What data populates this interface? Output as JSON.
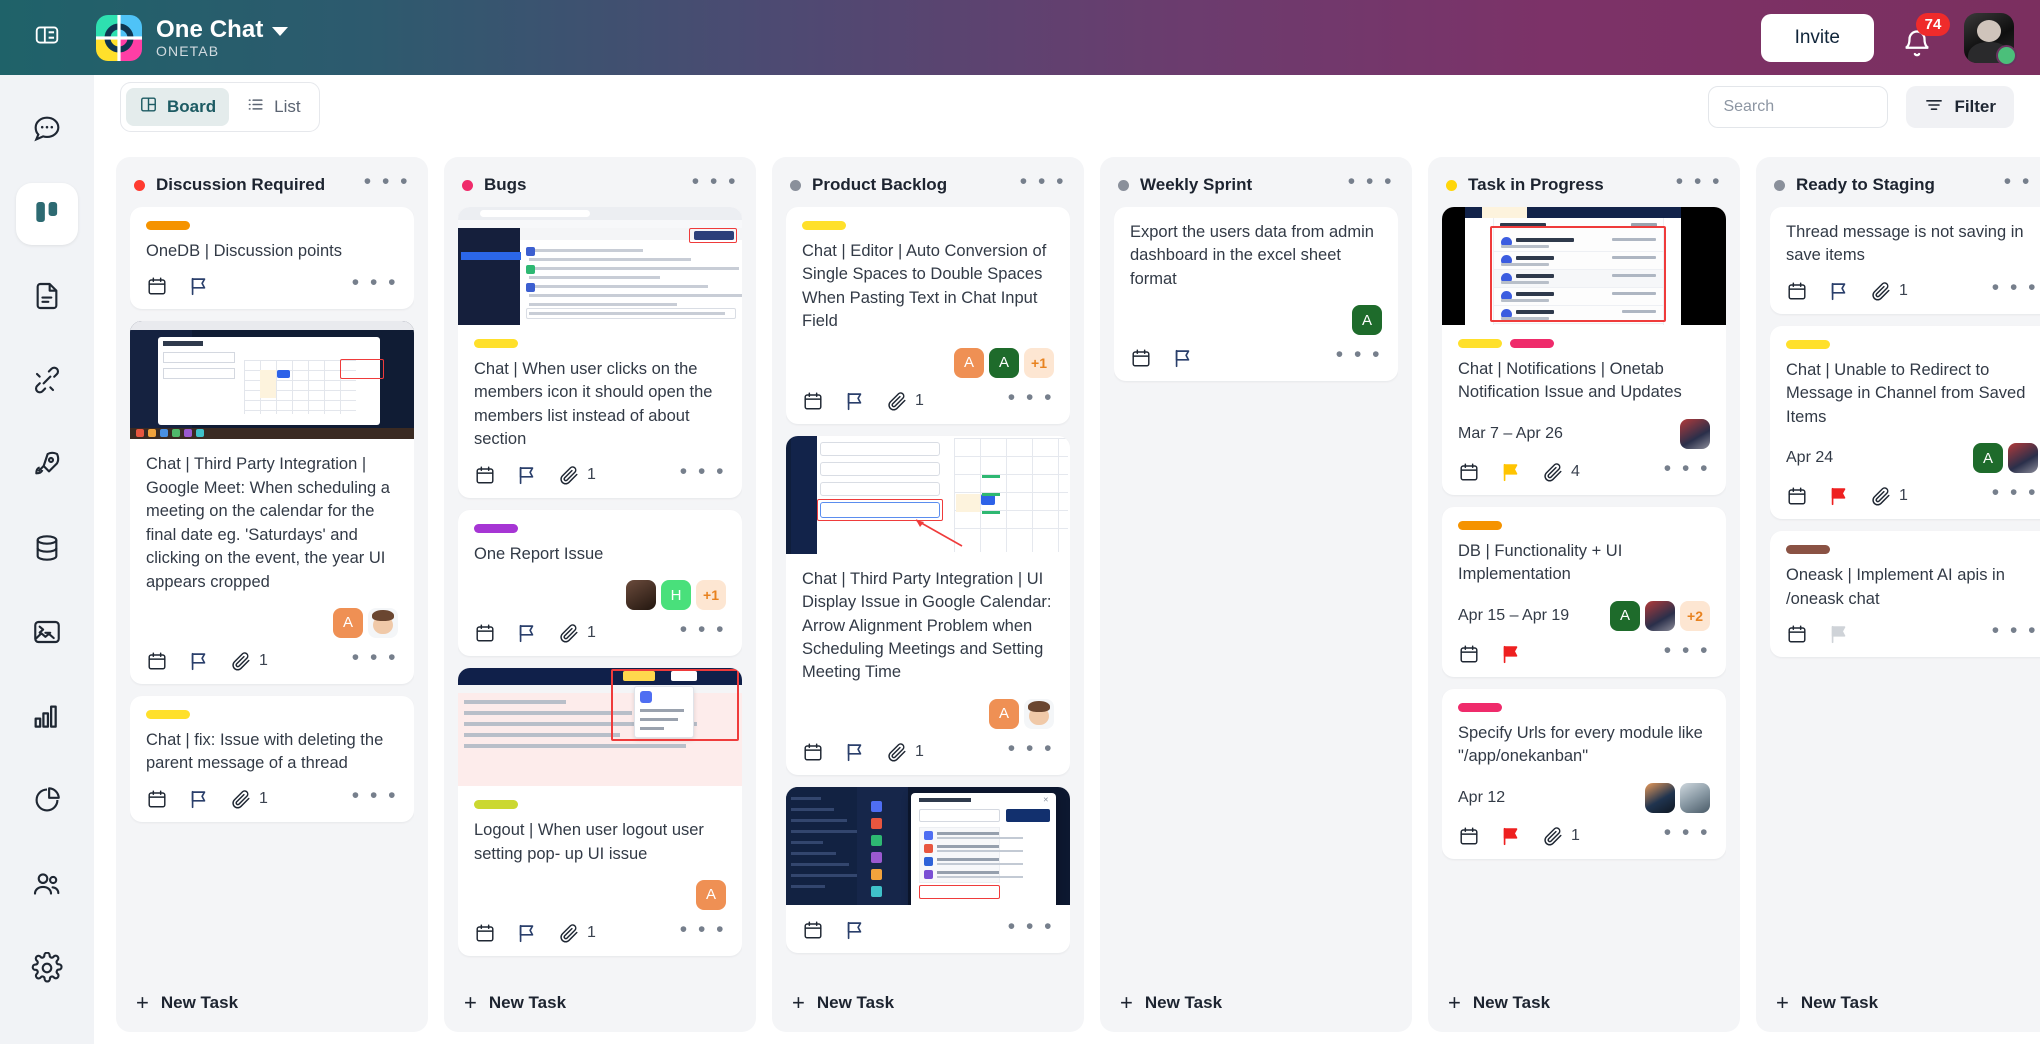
{
  "topbar": {
    "panel_toggle_icon": "panel-layout-icon",
    "brand_title": "One Chat",
    "brand_subtitle": "ONETAB",
    "brand_chevron_icon": "chevron-down-icon",
    "invite_label": "Invite",
    "bell_icon": "bell-icon",
    "notification_count": "74",
    "avatar_icon": "user-avatar",
    "gradient_from": "#1f6269",
    "gradient_to": "#7b2f5f"
  },
  "rail": {
    "items": [
      {
        "name": "chat",
        "icon": "chat-bubble-icon",
        "active": false
      },
      {
        "name": "board",
        "icon": "board-columns-icon",
        "active": true
      },
      {
        "name": "docs",
        "icon": "document-icon",
        "active": false
      },
      {
        "name": "integrations",
        "icon": "plug-connect-icon",
        "active": false
      },
      {
        "name": "launch",
        "icon": "rocket-icon",
        "active": false
      },
      {
        "name": "database",
        "icon": "database-icon",
        "active": false
      },
      {
        "name": "terminal",
        "icon": "terminal-image-icon",
        "active": false
      },
      {
        "name": "analytics",
        "icon": "bar-chart-icon",
        "active": false
      },
      {
        "name": "reports",
        "icon": "pie-chart-icon",
        "active": false
      },
      {
        "name": "members",
        "icon": "users-icon",
        "active": false
      },
      {
        "name": "settings",
        "icon": "gear-icon",
        "active": false
      }
    ]
  },
  "toolbar": {
    "board_tab": "Board",
    "board_icon": "board-grid-icon",
    "list_tab": "List",
    "list_icon": "list-icon",
    "search_placeholder": "Search",
    "search_value": "",
    "search_icon": "search-icon",
    "filter_label": "Filter",
    "filter_icon": "filter-icon",
    "menu_glyph": "• • •",
    "plus_glyph": "+"
  },
  "columns": [
    {
      "title": "Discussion Required",
      "dot_color": "#ff3b30",
      "new_task_label": "New Task",
      "cards": [
        {
          "title": "OneDB | Discussion points",
          "labels": [
            "#f59300"
          ],
          "cover": null,
          "date": "",
          "attachments": "",
          "avatars": [],
          "flag_color": "#2a3f6b"
        },
        {
          "title": "Chat | Third Party Integration | Google Meet: When scheduling a meeting on the calendar for the final date eg. 'Saturdays' and clicking on the event, the year UI appears cropped",
          "labels": [],
          "cover": "calendar-create-meet-screenshot",
          "date": "",
          "attachments": "1",
          "avatars": [
            {
              "type": "initial",
              "text": "A",
              "color": "#ef9054"
            },
            {
              "type": "memoji",
              "text": ""
            }
          ],
          "flag_color": "#2a3f6b"
        },
        {
          "title": "Chat | fix: Issue with deleting the parent message of a thread",
          "labels": [
            "#ffe02b"
          ],
          "cover": null,
          "date": "",
          "attachments": "1",
          "avatars": [],
          "flag_color": "#2a3f6b"
        }
      ]
    },
    {
      "title": "Bugs",
      "dot_color": "#ef2b6b",
      "new_task_label": "New Task",
      "cards": [
        {
          "title": "Chat | When user clicks on the members icon it should open the members list instead of about section",
          "labels": [
            "#ffe02b"
          ],
          "cover": "chat-channel-browser-screenshot",
          "date": "",
          "attachments": "1",
          "avatars": [],
          "flag_color": "#2a3f6b"
        },
        {
          "title": "One Report Issue",
          "labels": [
            "#a635d4"
          ],
          "cover": null,
          "date": "",
          "attachments": "1",
          "avatars": [
            {
              "type": "photo-a",
              "text": ""
            },
            {
              "type": "initial",
              "text": "H",
              "color": "#49e07b"
            },
            {
              "type": "more",
              "text": "+1"
            }
          ],
          "flag_color": "#2a3f6b"
        },
        {
          "title": "Logout | When user logout user setting pop- up UI issue",
          "labels": [
            "#cbd831"
          ],
          "cover": "logout-popup-screenshot",
          "date": "",
          "attachments": "1",
          "avatars": [
            {
              "type": "initial",
              "text": "A",
              "color": "#ef9054"
            }
          ],
          "flag_color": "#2a3f6b"
        }
      ]
    },
    {
      "title": "Product Backlog",
      "dot_color": "#8a909b",
      "new_task_label": "New Task",
      "cards": [
        {
          "title": "Chat | Editor | Auto Conversion of Single Spaces to Double Spaces When Pasting Text in Chat Input Field",
          "labels": [
            "#ffe02b"
          ],
          "cover": null,
          "date": "",
          "attachments": "1",
          "avatars": [
            {
              "type": "initial",
              "text": "A",
              "color": "#ef9054"
            },
            {
              "type": "initial",
              "text": "A",
              "color": "#1e6b2b"
            },
            {
              "type": "more",
              "text": "+1"
            }
          ],
          "flag_color": "#2a3f6b"
        },
        {
          "title": "Chat | Third Party Integration | UI Display Issue in Google Calendar: Arrow Alignment Problem when Scheduling Meetings and Setting Meeting Time",
          "labels": [],
          "cover": "google-calendar-schedule-screenshot",
          "date": "",
          "attachments": "1",
          "avatars": [
            {
              "type": "initial",
              "text": "A",
              "color": "#ef9054"
            },
            {
              "type": "memoji",
              "text": ""
            }
          ],
          "flag_color": "#2a3f6b"
        },
        {
          "title": "",
          "labels": [],
          "cover": "workspace-invite-screenshot",
          "date": "",
          "attachments": "",
          "avatars": [],
          "flag_color": "#2a3f6b"
        }
      ]
    },
    {
      "title": "Weekly Sprint",
      "dot_color": "#8a909b",
      "new_task_label": "New Task",
      "cards": [
        {
          "title": "Export the users data from admin dashboard in the excel sheet format",
          "labels": [],
          "cover": null,
          "date": "",
          "attachments": "",
          "avatars": [
            {
              "type": "initial",
              "text": "A",
              "color": "#1e6b2b"
            }
          ],
          "flag_color": "#2a3f6b"
        }
      ]
    },
    {
      "title": "Task in Progress",
      "dot_color": "#ffd60a",
      "new_task_label": "New Task",
      "cards": [
        {
          "title": "Chat | Notifications | Onetab Notification Issue and Updates",
          "labels": [
            "#ffe02b",
            "#ef2b6b"
          ],
          "cover": "notifications-panel-screenshot",
          "date": "Mar 7 – Apr 26",
          "attachments": "4",
          "avatars": [
            {
              "type": "photo-b",
              "text": ""
            }
          ],
          "flag_color": "#ffc400"
        },
        {
          "title": "DB | Functionality + UI Implementation",
          "labels": [
            "#f59300"
          ],
          "cover": null,
          "date": "Apr 15 – Apr 19",
          "attachments": "",
          "avatars": [
            {
              "type": "initial",
              "text": "A",
              "color": "#1e6b2b"
            },
            {
              "type": "photo-b",
              "text": ""
            },
            {
              "type": "more",
              "text": "+2"
            }
          ],
          "flag_color": "#ee2020"
        },
        {
          "title": "Specify Urls for every module like \"/app/onekanban\"",
          "labels": [
            "#ef2b6b"
          ],
          "cover": null,
          "date": "Apr 12",
          "attachments": "1",
          "avatars": [
            {
              "type": "photo-c",
              "text": ""
            },
            {
              "type": "photo-d",
              "text": ""
            }
          ],
          "flag_color": "#ee2020"
        }
      ]
    },
    {
      "title": "Ready to Staging",
      "dot_color": "#8a909b",
      "new_task_label": "New Task",
      "cards": [
        {
          "title": "Thread message is not saving in save items",
          "labels": [],
          "cover": null,
          "date": "",
          "attachments": "1",
          "avatars": [],
          "flag_color": "#2a3f6b"
        },
        {
          "title": "Chat | Unable to Redirect to Message in Channel from Saved Items",
          "labels": [
            "#ffe02b"
          ],
          "cover": null,
          "date": "Apr 24",
          "attachments": "1",
          "avatars": [
            {
              "type": "initial",
              "text": "A",
              "color": "#1e6b2b"
            },
            {
              "type": "photo-b",
              "text": ""
            }
          ],
          "flag_color": "#ee2020"
        },
        {
          "title": "Oneask | Implement AI apis in /oneask chat",
          "labels": [
            "#8a5244"
          ],
          "cover": null,
          "date": "",
          "attachments": "",
          "avatars": [],
          "flag_color": "#cfd3d8"
        }
      ]
    }
  ]
}
